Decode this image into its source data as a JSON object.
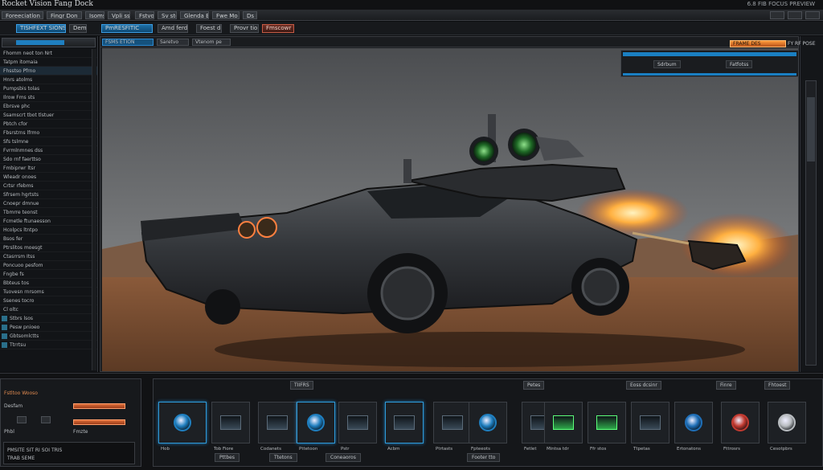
{
  "titlebar": {
    "title": "Rocket Vision Fang Dock",
    "right": "6.8 FIB FOCUS PREVIEW"
  },
  "menu": [
    "Foreeciatlon",
    "Fingr Don",
    "Isoms",
    "Vpli ss",
    "Fstvoe",
    "Sv ston",
    "Glenda Bar",
    "Fwe Mo",
    "Ds lk"
  ],
  "toolbar": [
    "TISHFEXT SIONS",
    "Dem Sh",
    "PmRESFITIC",
    "Amd ferdlr",
    "Foest dm",
    "Provr tio",
    "Fmscowr"
  ],
  "left_panel": {
    "rows": [
      "Fhomm neot ton Nrt",
      "Tatpm itomaia",
      "Fhsstso Pfrno",
      "Hnrs atolms",
      "Pumpsbis tolas",
      "Ilrow Fms sts",
      "Ebrsve phc",
      "Ssamscrt tbot tlstuer",
      "Pbtch cfor",
      "Fbsrstrns lfrmo",
      "Sfs tslmne",
      "Fvrmlnmnes dss",
      "Sdo rnf faerttso",
      "Fmbiprwr ltsr",
      "Wleadr onoes",
      "Crtsr rfebms",
      "Sfrsem hgrtsts",
      "Cnoepr dmnue",
      "Tbmrre teonst",
      "Fcmetle ftunaesson",
      "Hcolpcs ltntpo",
      "Bsos fer",
      "Ptrslitos moesgt",
      "Ctasrrsm Itss",
      "Poncuoo pesfom",
      "Fngbe fs",
      "Bbteus tos",
      "Tuovesn rnrsoms",
      "Ssenes tocro",
      "Cl oltc",
      "Stbrs lsos",
      "Pesw pnioeo",
      "Gbtsomlctts",
      "Ttrrtsu"
    ]
  },
  "viewport": {
    "tabs": [
      "FSMS ETION",
      "Saretvo",
      "Vtenom pe"
    ]
  },
  "overlay": {
    "badge": "FRAME DES",
    "label": "FY RF POSE"
  },
  "float_panel": {
    "labels": [
      "Sdrbum",
      "Fatfotss"
    ]
  },
  "bottom_left": {
    "title": "Fstltoo  Wooso",
    "rows": [
      "Desfam",
      "Phbl",
      "Fmzte"
    ],
    "footer": [
      "PMSITE SIT RI SOI TRIS",
      "TRAB SEME"
    ]
  },
  "bottom_main": {
    "tabs": [
      "TIIFRS",
      "Petes",
      "Eoss dcsinr",
      "Finre",
      "Fhtoest"
    ],
    "assets": [
      {
        "cap": "Hob",
        "kind": "ring"
      },
      {
        "cap": "Tob Fiore",
        "kind": "screen"
      },
      {
        "cap": "Codanets",
        "kind": "screen"
      },
      {
        "cap": "Pttetoon",
        "kind": "ring"
      },
      {
        "cap": "Pstr",
        "kind": "screen"
      },
      {
        "cap": "Acbm",
        "kind": "screen"
      },
      {
        "cap": "Ptrtasts",
        "kind": "screen"
      },
      {
        "cap": "Fpteeots",
        "kind": "ring"
      },
      {
        "cap": "Fetlet",
        "kind": "screen"
      },
      {
        "cap": "Mintsa tdr",
        "kind": "green"
      },
      {
        "cap": "Ffr stos",
        "kind": "green"
      },
      {
        "cap": "Ttpetas",
        "kind": "screen"
      },
      {
        "cap": "Ertonatons",
        "kind": "sphere"
      },
      {
        "cap": "Fttrosrs",
        "kind": "red"
      },
      {
        "cap": "Cesotpbrs",
        "kind": "silver"
      }
    ],
    "bottom_buttons": [
      "Pttbes",
      "Ttetons",
      "Coneaoros",
      "Footer tto"
    ]
  },
  "colors": {
    "accent": "#1f7fc0",
    "warning": "#e0703a",
    "bg": "#111214"
  }
}
